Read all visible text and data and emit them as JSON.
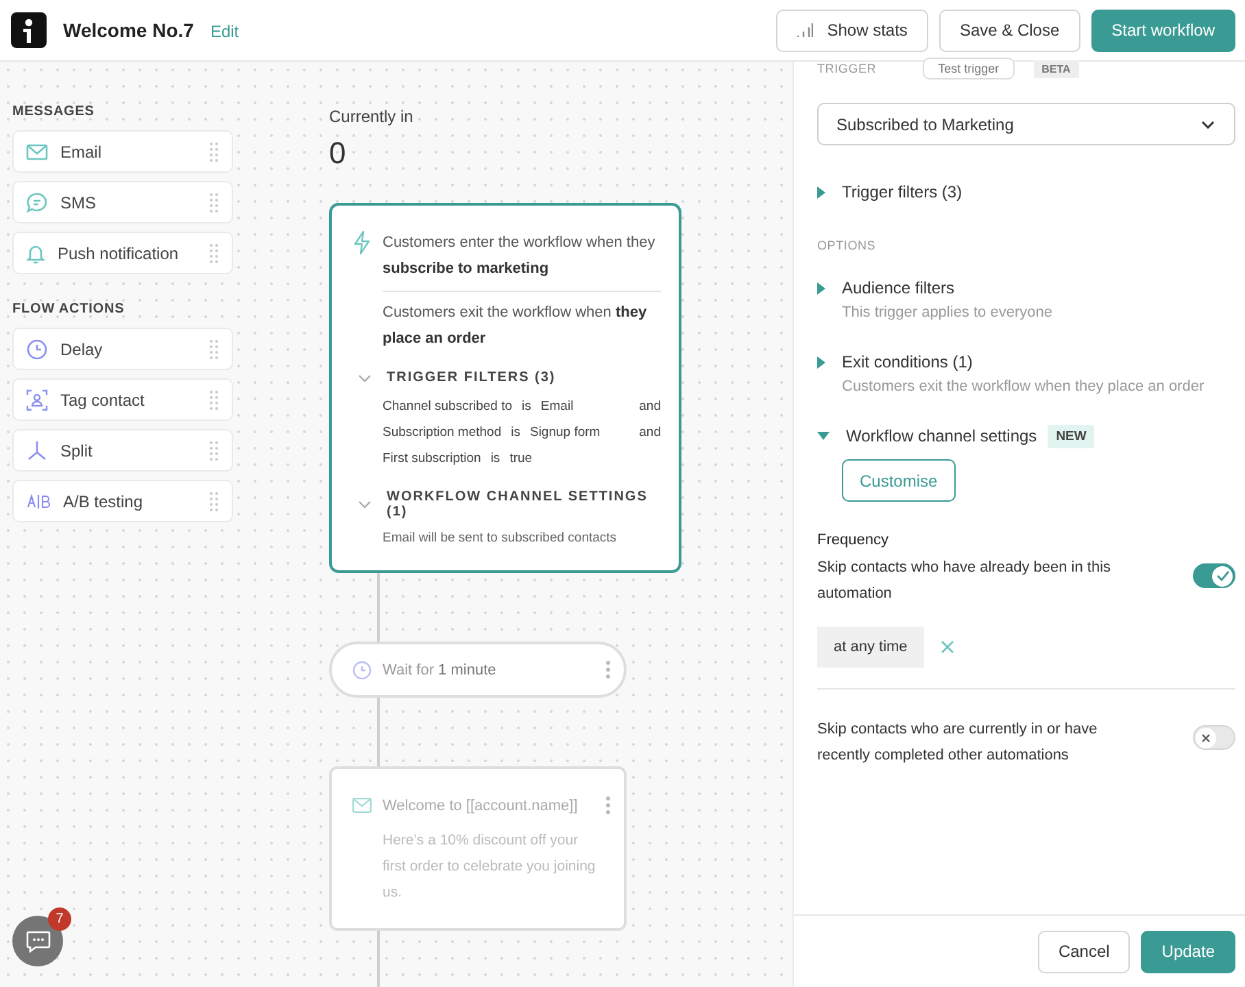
{
  "header": {
    "title": "Welcome No.7",
    "edit_link": "Edit",
    "buttons": [
      {
        "label": "Show stats",
        "kind": "stats"
      },
      {
        "label": "Save & Close",
        "kind": "secondary"
      },
      {
        "label": "Start workflow",
        "kind": "primary"
      }
    ]
  },
  "palette": [
    {
      "heading": "MESSAGES",
      "items": [
        {
          "label": "Email",
          "kind": "email"
        },
        {
          "label": "SMS",
          "kind": "sms"
        },
        {
          "label": "Push notification",
          "kind": "push"
        }
      ]
    },
    {
      "heading": "FLOW ACTIONS",
      "items": [
        {
          "label": "Delay",
          "kind": "delay"
        },
        {
          "label": "Tag contact",
          "kind": "tag"
        },
        {
          "label": "Split",
          "kind": "split"
        },
        {
          "label": "A/B testing",
          "kind": "ab"
        }
      ]
    }
  ],
  "flow": {
    "currently_label": "Currently in",
    "count": "0",
    "trigger_card": {
      "enter_text": "Customers enter the workflow when they **subscribe to marketing**",
      "exit_text": "Customers exit the workflow when **they place an order**",
      "sections": [
        {
          "heading": "TRIGGER FILTERS (3)",
          "expanded": true,
          "rows": [
            {
              "field": "Channel subscribed to",
              "op": "is",
              "value": "Email",
              "joiner": "and"
            },
            {
              "field": "Subscription method",
              "op": "is",
              "value": "Signup form",
              "joiner": "and"
            },
            {
              "field": "First subscription",
              "op": "is",
              "value": "true"
            }
          ]
        },
        {
          "heading": "WORKFLOW CHANNEL SETTINGS (1)",
          "expanded": true,
          "note": "Email will be sent to subscribed contacts"
        }
      ]
    },
    "nodes": [
      {
        "kind": "wait",
        "text": "Wait for **1 minute**"
      },
      {
        "kind": "email",
        "title": "Welcome to [[account.name]]",
        "body": "Here’s a 10% discount off your first order to celebrate you joining us."
      }
    ]
  },
  "panel": {
    "trigger_label": "TRIGGER",
    "test_button": "Test trigger",
    "beta_badge": "BETA",
    "select_value": "Subscribed to Marketing",
    "trigger_filters": {
      "label": "Trigger filters (3)",
      "expanded": false
    },
    "options_heading": "OPTIONS",
    "options": [
      {
        "title": "Audience filters",
        "subtitle": "This trigger applies to everyone",
        "expanded": false
      },
      {
        "title": "Exit conditions (1)",
        "subtitle": "Customers exit the workflow when they place an order",
        "expanded": false
      },
      {
        "title": "Workflow channel settings",
        "badge": "NEW",
        "button": "Customise",
        "expanded": true
      }
    ],
    "frequency": {
      "heading": "Frequency",
      "text": "Skip contacts who have already been in this automation",
      "on": true,
      "chip": "at any time"
    },
    "other": {
      "text": "Skip contacts who are currently in or have recently completed other automations",
      "on": false
    },
    "footer": [
      {
        "label": "Cancel",
        "kind": "secondary"
      },
      {
        "label": "Update",
        "kind": "primary"
      }
    ]
  },
  "chat": {
    "badge": "7"
  }
}
